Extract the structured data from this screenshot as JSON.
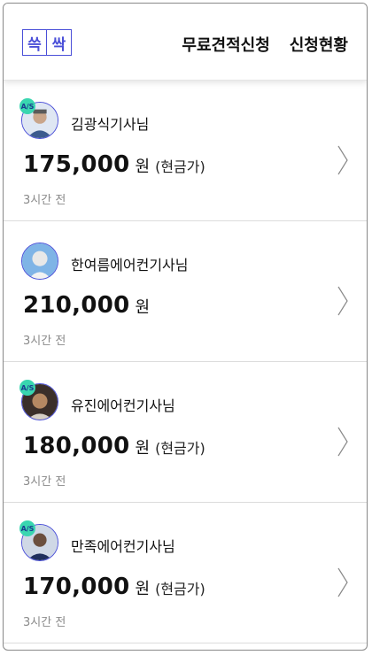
{
  "header": {
    "logo_char_1": "쓱",
    "logo_char_2": "싹",
    "nav_free_quote": "무료견적신청",
    "nav_status": "신청현황"
  },
  "quotes": [
    {
      "technician": "김광식기사님",
      "amount": "175,000",
      "unit": "원",
      "cash_note": "(현금가)",
      "time_ago": "3시간 전",
      "as_badge": "A/S",
      "avatar_icon": "technician-avatar"
    },
    {
      "technician": "한여름에어컨기사님",
      "amount": "210,000",
      "unit": "원",
      "cash_note": "",
      "time_ago": "3시간 전",
      "as_badge": "",
      "avatar_icon": "technician-avatar"
    },
    {
      "technician": "유진에어컨기사님",
      "amount": "180,000",
      "unit": "원",
      "cash_note": "(현금가)",
      "time_ago": "3시간 전",
      "as_badge": "A/S",
      "avatar_icon": "technician-avatar"
    },
    {
      "technician": "만족에어컨기사님",
      "amount": "170,000",
      "unit": "원",
      "cash_note": "(현금가)",
      "time_ago": "3시간 전",
      "as_badge": "A/S",
      "avatar_icon": "technician-avatar"
    }
  ],
  "colors": {
    "brand": "#4a4fd8",
    "badge": "#39d6b0",
    "muted": "#8a8a8a"
  }
}
